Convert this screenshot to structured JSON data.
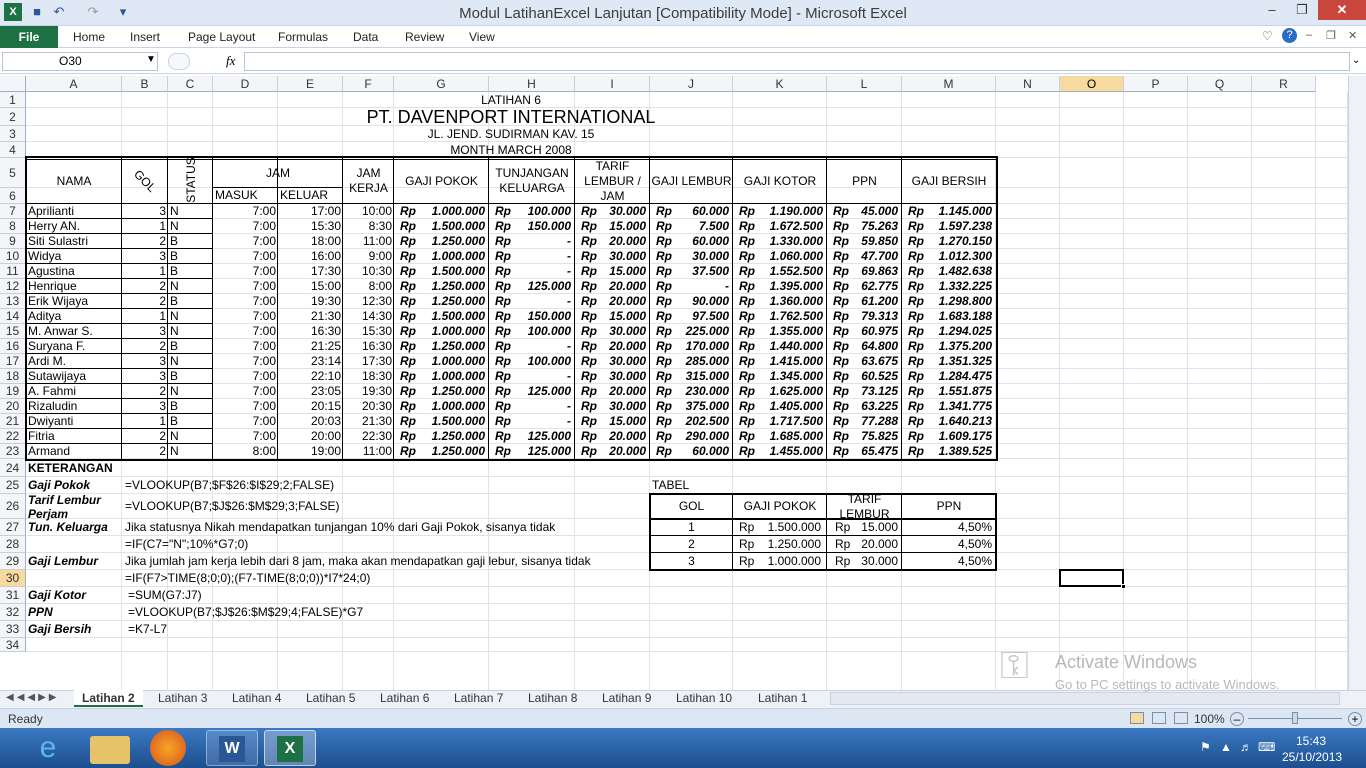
{
  "window": {
    "title": "Modul LatihanExcel Lanjutan  [Compatibility Mode]  -  Microsoft Excel"
  },
  "ribbon": {
    "file": "File",
    "tabs": [
      "Home",
      "Insert",
      "Page Layout",
      "Formulas",
      "Data",
      "Review",
      "View"
    ]
  },
  "formula_bar": {
    "name_box": "O30",
    "fx": "fx",
    "content": ""
  },
  "columns": [
    "A",
    "B",
    "C",
    "D",
    "E",
    "F",
    "G",
    "H",
    "I",
    "J",
    "K",
    "L",
    "M",
    "N",
    "O",
    "P",
    "Q",
    "R"
  ],
  "rows": [
    "1",
    "2",
    "3",
    "4",
    "5",
    "6",
    "7",
    "8",
    "9",
    "10",
    "11",
    "12",
    "13",
    "14",
    "15",
    "16",
    "17",
    "18",
    "19",
    "20",
    "21",
    "22",
    "23",
    "24",
    "25",
    "26",
    "27",
    "28",
    "29",
    "30",
    "31",
    "32",
    "33",
    "34"
  ],
  "sheet": {
    "title1": "LATIHAN 6",
    "title2": "PT. DAVENPORT INTERNATIONAL",
    "title3": "JL. JEND. SUDIRMAN KAV. 15",
    "title4": "MONTH MARCH 2008",
    "headers": {
      "nama": "NAMA",
      "gol": "GOL",
      "status": "STATUS",
      "jam": "JAM",
      "masuk": "MASUK",
      "keluar": "KELUAR",
      "jam_kerja": "JAM KERJA",
      "gaji_pokok": "GAJI POKOK",
      "tunjangan": "TUNJANGAN KELUARGA",
      "tarif": "TARIF LEMBUR / JAM",
      "gaji_lembur": "GAJI LEMBUR",
      "gaji_kotor": "GAJI KOTOR",
      "ppn": "PPN",
      "gaji_bersih": "GAJI BERSIH"
    },
    "rp": "Rp",
    "data": [
      [
        "Aprilianti",
        "3",
        "N",
        "7:00",
        "17:00",
        "10:00",
        "1.000.000",
        "100.000",
        "30.000",
        "60.000",
        "1.190.000",
        "45.000",
        "1.145.000"
      ],
      [
        "Herry AN.",
        "1",
        "N",
        "7:00",
        "15:30",
        "8:30",
        "1.500.000",
        "150.000",
        "15.000",
        "7.500",
        "1.672.500",
        "75.263",
        "1.597.238"
      ],
      [
        "Siti Sulastri",
        "2",
        "B",
        "7:00",
        "18:00",
        "11:00",
        "1.250.000",
        "-",
        "20.000",
        "60.000",
        "1.330.000",
        "59.850",
        "1.270.150"
      ],
      [
        "Widya",
        "3",
        "B",
        "7:00",
        "16:00",
        "9:00",
        "1.000.000",
        "-",
        "30.000",
        "30.000",
        "1.060.000",
        "47.700",
        "1.012.300"
      ],
      [
        "Agustina",
        "1",
        "B",
        "7:00",
        "17:30",
        "10:30",
        "1.500.000",
        "-",
        "15.000",
        "37.500",
        "1.552.500",
        "69.863",
        "1.482.638"
      ],
      [
        "Henrique",
        "2",
        "N",
        "7:00",
        "15:00",
        "8:00",
        "1.250.000",
        "125.000",
        "20.000",
        "-",
        "1.395.000",
        "62.775",
        "1.332.225"
      ],
      [
        "Erik Wijaya",
        "2",
        "B",
        "7:00",
        "19:30",
        "12:30",
        "1.250.000",
        "-",
        "20.000",
        "90.000",
        "1.360.000",
        "61.200",
        "1.298.800"
      ],
      [
        "Aditya",
        "1",
        "N",
        "7:00",
        "21:30",
        "14:30",
        "1.500.000",
        "150.000",
        "15.000",
        "97.500",
        "1.762.500",
        "79.313",
        "1.683.188"
      ],
      [
        "M. Anwar S.",
        "3",
        "N",
        "7:00",
        "16:30",
        "15:30",
        "1.000.000",
        "100.000",
        "30.000",
        "225.000",
        "1.355.000",
        "60.975",
        "1.294.025"
      ],
      [
        "Suryana F.",
        "2",
        "B",
        "7:00",
        "21:25",
        "16:30",
        "1.250.000",
        "-",
        "20.000",
        "170.000",
        "1.440.000",
        "64.800",
        "1.375.200"
      ],
      [
        "Ardi M.",
        "3",
        "N",
        "7:00",
        "23:14",
        "17:30",
        "1.000.000",
        "100.000",
        "30.000",
        "285.000",
        "1.415.000",
        "63.675",
        "1.351.325"
      ],
      [
        "Sutawijaya",
        "3",
        "B",
        "7:00",
        "22:10",
        "18:30",
        "1.000.000",
        "-",
        "30.000",
        "315.000",
        "1.345.000",
        "60.525",
        "1.284.475"
      ],
      [
        "A. Fahmi",
        "2",
        "N",
        "7:00",
        "23:05",
        "19:30",
        "1.250.000",
        "125.000",
        "20.000",
        "230.000",
        "1.625.000",
        "73.125",
        "1.551.875"
      ],
      [
        "Rizaludin",
        "3",
        "B",
        "7:00",
        "20:15",
        "20:30",
        "1.000.000",
        "-",
        "30.000",
        "375.000",
        "1.405.000",
        "63.225",
        "1.341.775"
      ],
      [
        "Dwiyanti",
        "1",
        "B",
        "7:00",
        "20:03",
        "21:30",
        "1.500.000",
        "-",
        "15.000",
        "202.500",
        "1.717.500",
        "77.288",
        "1.640.213"
      ],
      [
        "Fitria",
        "2",
        "N",
        "7:00",
        "20:00",
        "22:30",
        "1.250.000",
        "125.000",
        "20.000",
        "290.000",
        "1.685.000",
        "75.825",
        "1.609.175"
      ],
      [
        "Armand",
        "2",
        "N",
        "8:00",
        "19:00",
        "11:00",
        "1.250.000",
        "125.000",
        "20.000",
        "60.000",
        "1.455.000",
        "65.475",
        "1.389.525"
      ]
    ],
    "keterangan": "KETERANGAN",
    "notes": [
      {
        "label": "Gaji Pokok",
        "text": "=VLOOKUP(B7;$F$26:$I$29;2;FALSE)"
      },
      {
        "label": "Tarif Lembur",
        "label2": "Perjam",
        "text": "=VLOOKUP(B7;$J$26:$M$29;3;FALSE)"
      },
      {
        "label": "Tun. Keluarga",
        "text": "Jika statusnya Nikah mendapatkan tunjangan 10% dari Gaji Pokok, sisanya tidak"
      },
      {
        "label": "",
        "text": "=IF(C7=\"N\";10%*G7;0)"
      },
      {
        "label": "Gaji Lembur",
        "text": "Jika jumlah jam kerja lebih dari 8 jam, maka akan mendapatkan gaji lebur, sisanya tidak"
      },
      {
        "label": "",
        "text": "=IF(F7>TIME(8;0;0);(F7-TIME(8;0;0))*I7*24;0)"
      },
      {
        "label": "Gaji Kotor",
        "text": "=SUM(G7:J7)"
      },
      {
        "label": "PPN",
        "text": "=VLOOKUP(B7;$J$26:$M$29;4;FALSE)*G7"
      },
      {
        "label": "Gaji Bersih",
        "text": "=K7-L7"
      }
    ],
    "tabel": {
      "caption": "TABEL",
      "headers": [
        "GOL",
        "GAJI POKOK",
        "TARIF LEMBUR",
        "PPN"
      ],
      "rows": [
        [
          "1",
          "1.500.000",
          "15.000",
          "4,50%"
        ],
        [
          "2",
          "1.250.000",
          "20.000",
          "4,50%"
        ],
        [
          "3",
          "1.000.000",
          "30.000",
          "4,50%"
        ]
      ]
    }
  },
  "sheet_tabs": [
    "Latihan 2",
    "Latihan 3",
    "Latihan 4",
    "Latihan 5",
    "Latihan 6",
    "Latihan 7",
    "Latihan 8",
    "Latihan 9",
    "Latihan 10",
    "Latihan 1"
  ],
  "status": {
    "ready": "Ready",
    "zoom": "100%"
  },
  "watermark": {
    "line1": "Activate Windows",
    "line2": "Go to PC settings to activate Windows."
  },
  "taskbar": {
    "time": "15:43",
    "date": "25/10/2013"
  }
}
